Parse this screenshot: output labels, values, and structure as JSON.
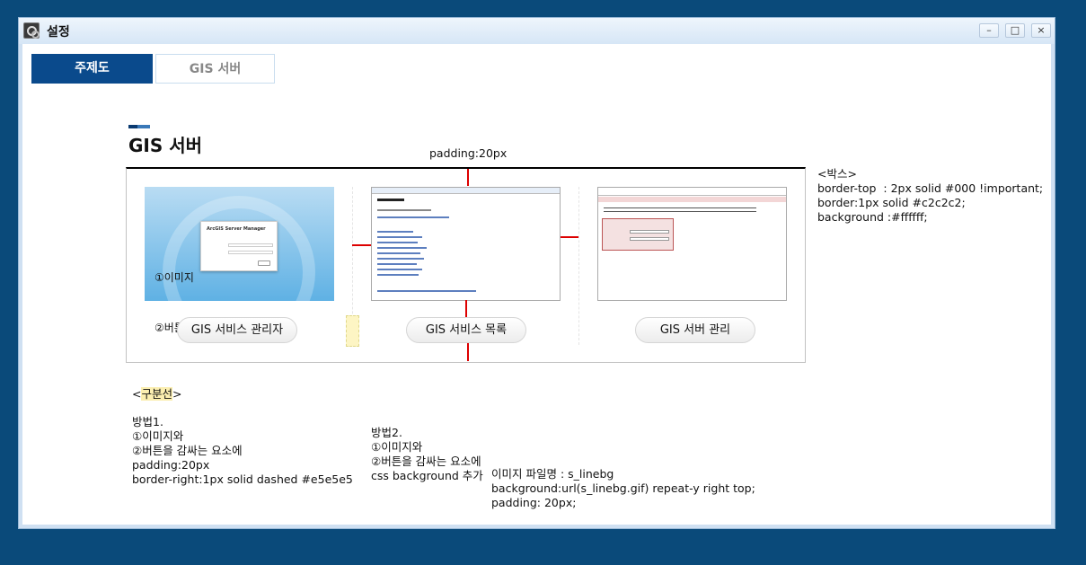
{
  "window": {
    "title": "설정",
    "controls": [
      "–",
      "□",
      "×"
    ]
  },
  "tabs": [
    {
      "label": "주제도",
      "active": true
    },
    {
      "label": "GIS 서버",
      "active": false
    }
  ],
  "section": {
    "title": "GIS 서버"
  },
  "annotations": {
    "padding_top": "padding:20px",
    "box_note": "<박스>\nborder-top  : 2px solid #000 !important;\nborder:1px solid #c2c2c2;\nbackground :#ffffff;",
    "divider_open": "<",
    "divider_word": "구분선",
    "divider_close": ">",
    "method1": "방법1.\n①이미지와\n②버튼을 감싸는 요소에\npadding:20px\nborder-right:1px solid dashed #e5e5e5",
    "method2": "방법2.\n①이미지와\n②버튼을 감싸는 요소에\ncss background 추가",
    "bg_note": "이미지 파일명 : s_linebg\nbackground:url(s_linebg.gif) repeat-y right top;\npadding: 20px;",
    "label_image": "①이미지",
    "label_button": "②버튼"
  },
  "cards": [
    {
      "button": "GIS 서비스 관리자",
      "thumb_title": "ArcGIS Server Manager",
      "thumb_top_links": "ArcGIS | Resource Center | Help"
    },
    {
      "button": "GIS 서비스 목록",
      "thumb_title": "ArcGIS REST Services Directory",
      "thumb_folder": "Folder: /"
    },
    {
      "button": "GIS 서버 관리",
      "thumb_title": "ArcGIS Server Administrator Directory",
      "thumb_login": "Login",
      "thumb_user": "User name:",
      "thumb_pass": "Password:"
    }
  ],
  "colors": {
    "brand": "#0a4a8c",
    "desktop": "#0a4a7a",
    "divider_red": "#dd0000"
  }
}
